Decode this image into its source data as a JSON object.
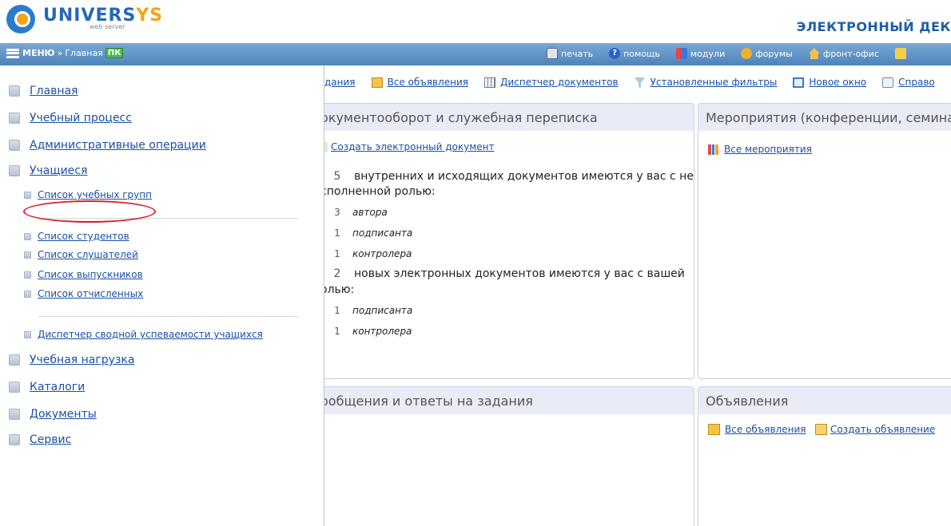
{
  "header": {
    "logo_main": "UNIVERS",
    "logo_accent": "YS",
    "logo_sub": "web server",
    "right_title": "ЭЛЕКТРОННЫЙ ДЕК"
  },
  "topbar": {
    "menu_label": "МЕНЮ",
    "separator": "»",
    "breadcrumb": "Главная",
    "badge": "ПК",
    "actions": [
      {
        "label": "печать",
        "icon": "print-icon"
      },
      {
        "label": "помощь",
        "icon": "help-icon"
      },
      {
        "label": "модули",
        "icon": "modules-icon"
      },
      {
        "label": "форумы",
        "icon": "forums-icon"
      },
      {
        "label": "фронт-офис",
        "icon": "front-office-icon"
      }
    ]
  },
  "sidemenu": {
    "main_items": [
      "Главная",
      "Учебный процесс",
      "Административные операции",
      "Учащиеся",
      "Учебная нагрузка",
      "Каталоги",
      "Документы",
      "Сервис"
    ],
    "sub_items": [
      "Список учебных групп",
      "Список студентов",
      "Список слушателей",
      "Список выпускников",
      "Список отчисленных",
      "Диспетчер сводной успеваемости учащихся"
    ]
  },
  "toolbar": {
    "items": [
      "дания",
      "Все объявления",
      "Диспетчер документов",
      "Установленные фильтры",
      "Новое окно",
      "Справо"
    ]
  },
  "panels": {
    "docs": {
      "title": "окументооборот и служебная переписка",
      "create_link": "Создать электронный документ",
      "stat1": {
        "count": "5",
        "text": "внутренних и исходящих документов имеются у вас с не",
        "cont": "сполненной ролью:"
      },
      "stat1_rows": [
        {
          "count": "3",
          "role": "автора"
        },
        {
          "count": "1",
          "role": "подписанта"
        },
        {
          "count": "1",
          "role": "контролера"
        }
      ],
      "stat2": {
        "count": "2",
        "text": "новых электронных документов имеются у вас с вашей",
        "cont": "олью:"
      },
      "stat2_rows": [
        {
          "count": "1",
          "role": "подписанта"
        },
        {
          "count": "1",
          "role": "контролера"
        }
      ]
    },
    "events": {
      "title": "Мероприятия (конференции, семина",
      "link": "Все мероприятия"
    },
    "messages": {
      "title": "ообщения и ответы на задания"
    },
    "announcements": {
      "title": "Объявления",
      "link_all": "Все объявления",
      "link_create": "Создать объявление"
    }
  }
}
